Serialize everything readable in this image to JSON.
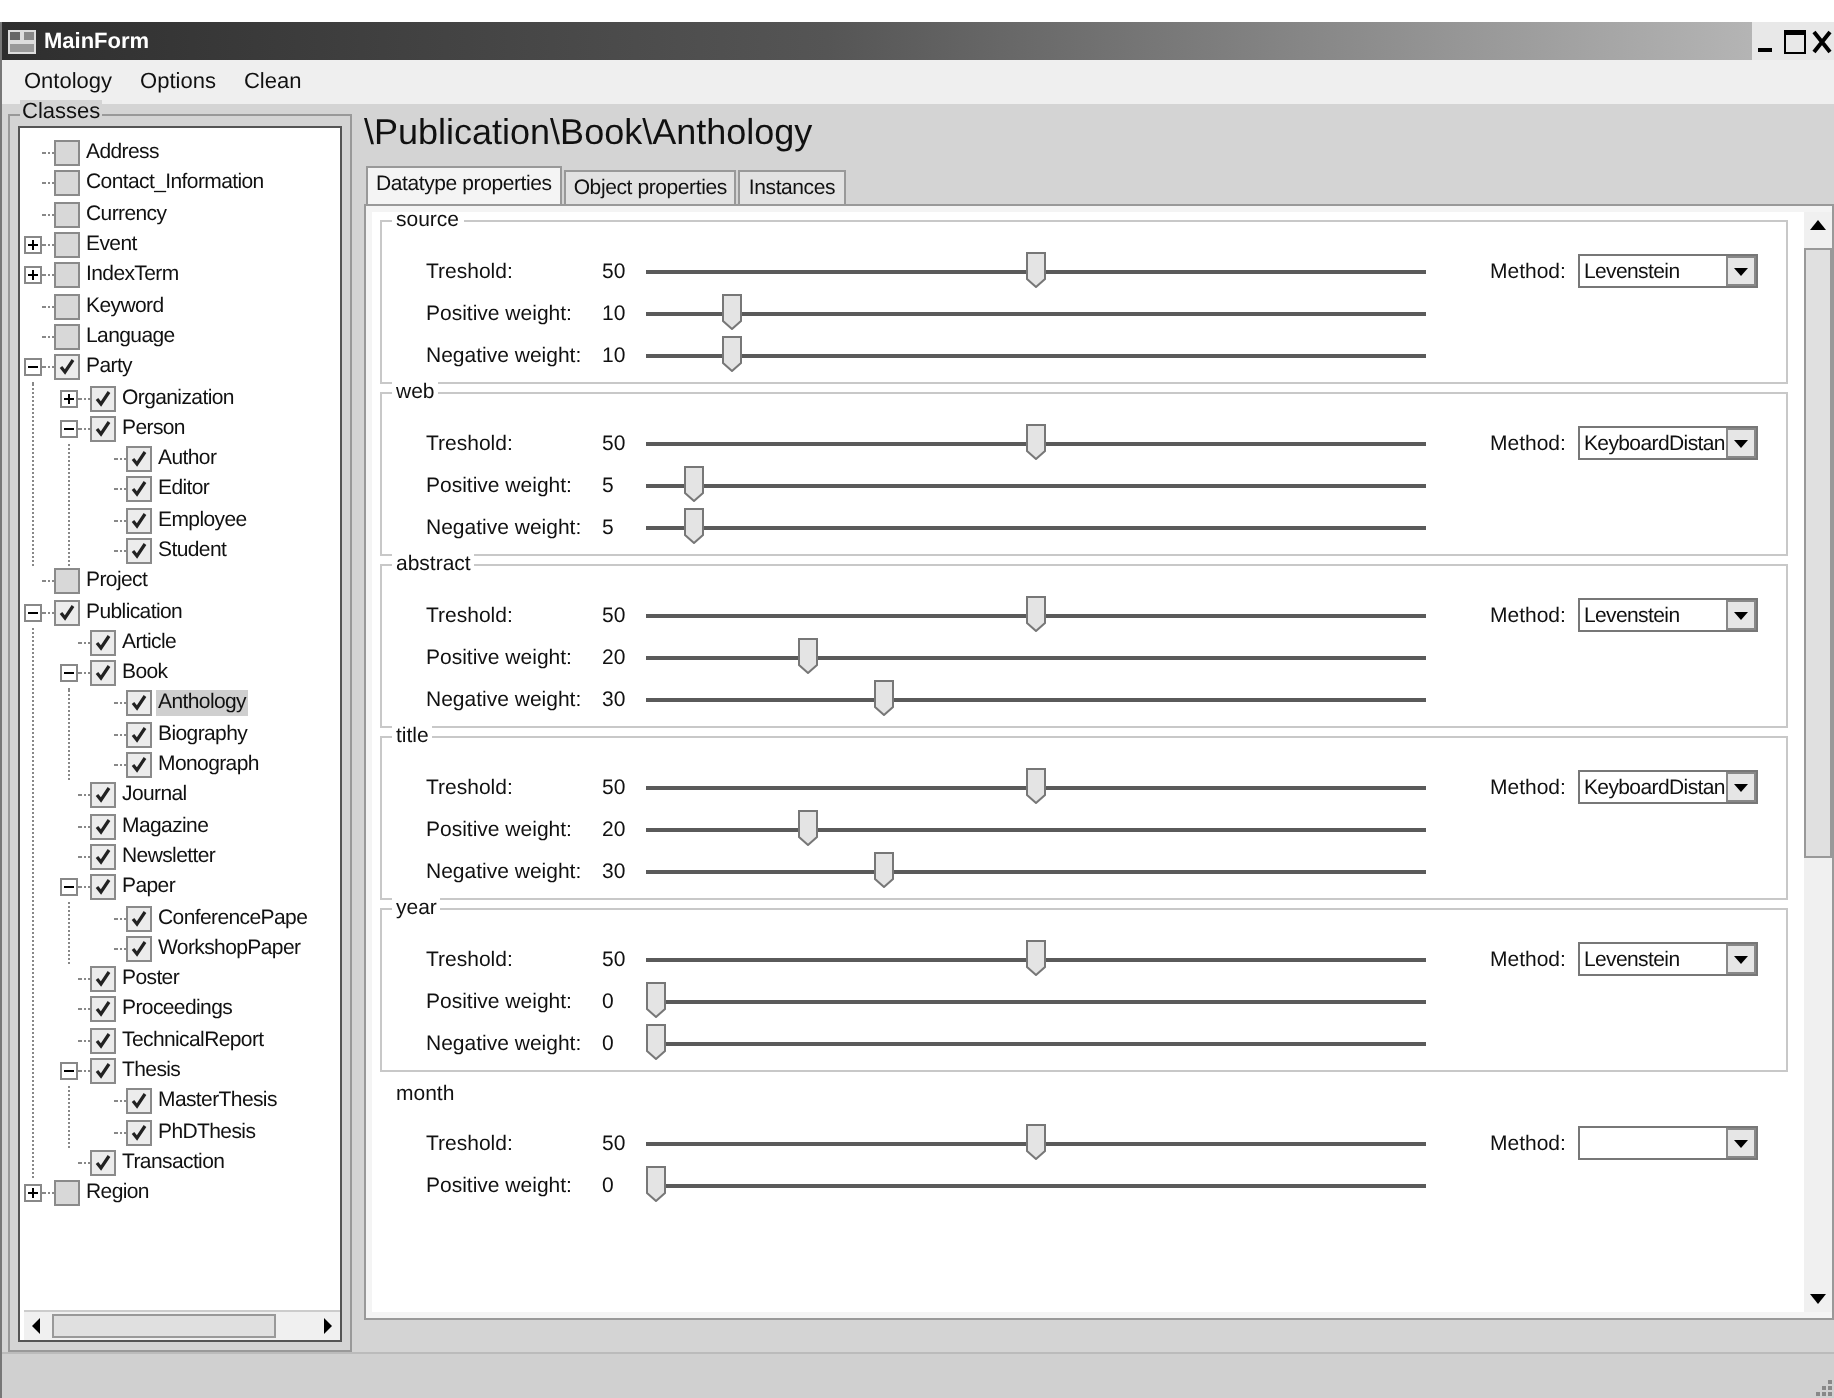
{
  "window": {
    "title": "MainForm"
  },
  "menu": [
    "Ontology",
    "Options",
    "Clean"
  ],
  "classes_panel": {
    "title": "Classes",
    "tree": [
      {
        "label": "Address",
        "checked": false,
        "selected": false
      },
      {
        "label": "Contact_Information",
        "checked": false,
        "selected": false
      },
      {
        "label": "Currency",
        "checked": false,
        "selected": false
      },
      {
        "label": "Event",
        "checked": false,
        "selected": false,
        "expanded": false
      },
      {
        "label": "IndexTerm",
        "checked": false,
        "selected": false,
        "expanded": false
      },
      {
        "label": "Keyword",
        "checked": false,
        "selected": false
      },
      {
        "label": "Language",
        "checked": false,
        "selected": false
      },
      {
        "label": "Party",
        "checked": true,
        "selected": false,
        "expanded": true,
        "children": [
          {
            "label": "Organization",
            "checked": true,
            "selected": false,
            "expanded": false
          },
          {
            "label": "Person",
            "checked": true,
            "selected": false,
            "expanded": true,
            "children": [
              {
                "label": "Author",
                "checked": true,
                "selected": false
              },
              {
                "label": "Editor",
                "checked": true,
                "selected": false
              },
              {
                "label": "Employee",
                "checked": true,
                "selected": false
              },
              {
                "label": "Student",
                "checked": true,
                "selected": false
              }
            ]
          }
        ]
      },
      {
        "label": "Project",
        "checked": false,
        "selected": false
      },
      {
        "label": "Publication",
        "checked": true,
        "selected": false,
        "expanded": true,
        "children": [
          {
            "label": "Article",
            "checked": true,
            "selected": false
          },
          {
            "label": "Book",
            "checked": true,
            "selected": false,
            "expanded": true,
            "children": [
              {
                "label": "Anthology",
                "checked": true,
                "selected": true
              },
              {
                "label": "Biography",
                "checked": true,
                "selected": false
              },
              {
                "label": "Monograph",
                "checked": true,
                "selected": false
              }
            ]
          },
          {
            "label": "Journal",
            "checked": true,
            "selected": false
          },
          {
            "label": "Magazine",
            "checked": true,
            "selected": false
          },
          {
            "label": "Newsletter",
            "checked": true,
            "selected": false
          },
          {
            "label": "Paper",
            "checked": true,
            "selected": false,
            "expanded": true,
            "children": [
              {
                "label": "ConferencePape",
                "checked": true,
                "selected": false
              },
              {
                "label": "WorkshopPaper",
                "checked": true,
                "selected": false
              }
            ]
          },
          {
            "label": "Poster",
            "checked": true,
            "selected": false
          },
          {
            "label": "Proceedings",
            "checked": true,
            "selected": false
          },
          {
            "label": "TechnicalReport",
            "checked": true,
            "selected": false
          },
          {
            "label": "Thesis",
            "checked": true,
            "selected": false,
            "expanded": true,
            "children": [
              {
                "label": "MasterThesis",
                "checked": true,
                "selected": false
              },
              {
                "label": "PhDThesis",
                "checked": true,
                "selected": false
              }
            ]
          },
          {
            "label": "Transaction",
            "checked": true,
            "selected": false
          }
        ]
      },
      {
        "label": "Region",
        "checked": false,
        "selected": false,
        "expanded": false
      }
    ]
  },
  "path_heading": "\\Publication\\Book\\Anthology",
  "tabs": [
    {
      "label": "Datatype properties",
      "selected": true
    },
    {
      "label": "Object properties",
      "selected": false
    },
    {
      "label": "Instances",
      "selected": false
    }
  ],
  "property_groups": [
    {
      "name": "source",
      "bordered": true,
      "sliders": [
        {
          "label": "Treshold:",
          "value": "50",
          "level": 0.5
        },
        {
          "label": "Positive weight:",
          "value": "10",
          "level": 0.1
        },
        {
          "label": "Negative weight:",
          "value": "10",
          "level": 0.1
        }
      ],
      "method": {
        "label": "Method:",
        "value": "Levenstein"
      }
    },
    {
      "name": "web",
      "bordered": true,
      "sliders": [
        {
          "label": "Treshold:",
          "value": "50",
          "level": 0.5
        },
        {
          "label": "Positive weight:",
          "value": "5",
          "level": 0.05
        },
        {
          "label": "Negative weight:",
          "value": "5",
          "level": 0.05
        }
      ],
      "method": {
        "label": "Method:",
        "value": "KeyboardDistan"
      }
    },
    {
      "name": "abstract",
      "bordered": true,
      "sliders": [
        {
          "label": "Treshold:",
          "value": "50",
          "level": 0.5
        },
        {
          "label": "Positive weight:",
          "value": "20",
          "level": 0.2
        },
        {
          "label": "Negative weight:",
          "value": "30",
          "level": 0.3
        }
      ],
      "method": {
        "label": "Method:",
        "value": "Levenstein"
      }
    },
    {
      "name": "title",
      "bordered": true,
      "sliders": [
        {
          "label": "Treshold:",
          "value": "50",
          "level": 0.5
        },
        {
          "label": "Positive weight:",
          "value": "20",
          "level": 0.2
        },
        {
          "label": "Negative weight:",
          "value": "30",
          "level": 0.3
        }
      ],
      "method": {
        "label": "Method:",
        "value": "KeyboardDistan"
      }
    },
    {
      "name": "year",
      "bordered": true,
      "sliders": [
        {
          "label": "Treshold:",
          "value": "50",
          "level": 0.5
        },
        {
          "label": "Positive weight:",
          "value": "0",
          "level": 0
        },
        {
          "label": "Negative weight:",
          "value": "0",
          "level": 0
        }
      ],
      "method": {
        "label": "Method:",
        "value": "Levenstein"
      }
    },
    {
      "name": "month",
      "bordered": false,
      "sliders": [
        {
          "label": "Treshold:",
          "value": "50",
          "level": 0.5
        },
        {
          "label": "Positive weight:",
          "value": "0",
          "level": 0
        }
      ],
      "method": {
        "label": "Method:"
      }
    }
  ]
}
